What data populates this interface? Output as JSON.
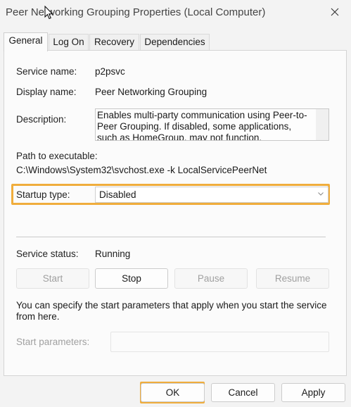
{
  "window": {
    "title": "Peer Networking Grouping Properties (Local Computer)"
  },
  "tabs": [
    {
      "label": "General",
      "active": true
    },
    {
      "label": "Log On",
      "active": false
    },
    {
      "label": "Recovery",
      "active": false
    },
    {
      "label": "Dependencies",
      "active": false
    }
  ],
  "general": {
    "service_name_label": "Service name:",
    "service_name": "p2psvc",
    "display_name_label": "Display name:",
    "display_name": "Peer Networking Grouping",
    "description_label": "Description:",
    "description": "Enables multi-party communication using Peer-to-Peer Grouping.  If disabled, some applications, such as HomeGroup, may not function.",
    "path_label": "Path to executable:",
    "path": "C:\\Windows\\System32\\svchost.exe -k LocalServicePeerNet",
    "startup_type_label": "Startup type:",
    "startup_type": "Disabled",
    "service_status_label": "Service status:",
    "service_status": "Running",
    "buttons": {
      "start": "Start",
      "stop": "Stop",
      "pause": "Pause",
      "resume": "Resume"
    },
    "info_text": "You can specify the start parameters that apply when you start the service from here.",
    "start_params_label": "Start parameters:",
    "start_params_value": ""
  },
  "footer": {
    "ok": "OK",
    "cancel": "Cancel",
    "apply": "Apply"
  },
  "colors": {
    "highlight": "#f0ad3c"
  },
  "icons": {
    "close": "close-icon",
    "dropdown": "chevron-down-icon",
    "cursor": "mouse-pointer-icon"
  }
}
